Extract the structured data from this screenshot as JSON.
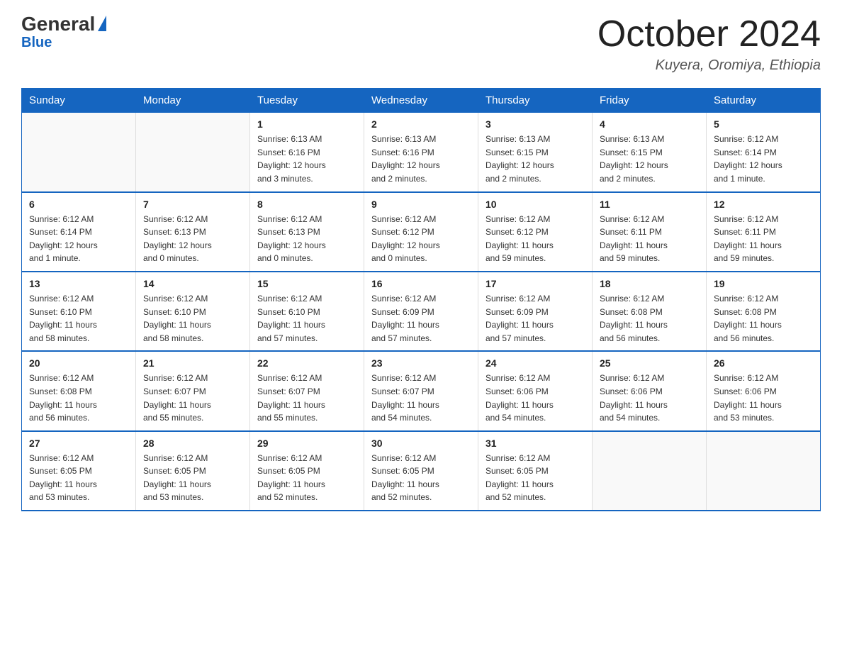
{
  "header": {
    "logo_general": "General",
    "logo_blue": "Blue",
    "month_title": "October 2024",
    "location": "Kuyera, Oromiya, Ethiopia"
  },
  "days_of_week": [
    "Sunday",
    "Monday",
    "Tuesday",
    "Wednesday",
    "Thursday",
    "Friday",
    "Saturday"
  ],
  "weeks": [
    [
      {
        "num": "",
        "info": ""
      },
      {
        "num": "",
        "info": ""
      },
      {
        "num": "1",
        "info": "Sunrise: 6:13 AM\nSunset: 6:16 PM\nDaylight: 12 hours\nand 3 minutes."
      },
      {
        "num": "2",
        "info": "Sunrise: 6:13 AM\nSunset: 6:16 PM\nDaylight: 12 hours\nand 2 minutes."
      },
      {
        "num": "3",
        "info": "Sunrise: 6:13 AM\nSunset: 6:15 PM\nDaylight: 12 hours\nand 2 minutes."
      },
      {
        "num": "4",
        "info": "Sunrise: 6:13 AM\nSunset: 6:15 PM\nDaylight: 12 hours\nand 2 minutes."
      },
      {
        "num": "5",
        "info": "Sunrise: 6:12 AM\nSunset: 6:14 PM\nDaylight: 12 hours\nand 1 minute."
      }
    ],
    [
      {
        "num": "6",
        "info": "Sunrise: 6:12 AM\nSunset: 6:14 PM\nDaylight: 12 hours\nand 1 minute."
      },
      {
        "num": "7",
        "info": "Sunrise: 6:12 AM\nSunset: 6:13 PM\nDaylight: 12 hours\nand 0 minutes."
      },
      {
        "num": "8",
        "info": "Sunrise: 6:12 AM\nSunset: 6:13 PM\nDaylight: 12 hours\nand 0 minutes."
      },
      {
        "num": "9",
        "info": "Sunrise: 6:12 AM\nSunset: 6:12 PM\nDaylight: 12 hours\nand 0 minutes."
      },
      {
        "num": "10",
        "info": "Sunrise: 6:12 AM\nSunset: 6:12 PM\nDaylight: 11 hours\nand 59 minutes."
      },
      {
        "num": "11",
        "info": "Sunrise: 6:12 AM\nSunset: 6:11 PM\nDaylight: 11 hours\nand 59 minutes."
      },
      {
        "num": "12",
        "info": "Sunrise: 6:12 AM\nSunset: 6:11 PM\nDaylight: 11 hours\nand 59 minutes."
      }
    ],
    [
      {
        "num": "13",
        "info": "Sunrise: 6:12 AM\nSunset: 6:10 PM\nDaylight: 11 hours\nand 58 minutes."
      },
      {
        "num": "14",
        "info": "Sunrise: 6:12 AM\nSunset: 6:10 PM\nDaylight: 11 hours\nand 58 minutes."
      },
      {
        "num": "15",
        "info": "Sunrise: 6:12 AM\nSunset: 6:10 PM\nDaylight: 11 hours\nand 57 minutes."
      },
      {
        "num": "16",
        "info": "Sunrise: 6:12 AM\nSunset: 6:09 PM\nDaylight: 11 hours\nand 57 minutes."
      },
      {
        "num": "17",
        "info": "Sunrise: 6:12 AM\nSunset: 6:09 PM\nDaylight: 11 hours\nand 57 minutes."
      },
      {
        "num": "18",
        "info": "Sunrise: 6:12 AM\nSunset: 6:08 PM\nDaylight: 11 hours\nand 56 minutes."
      },
      {
        "num": "19",
        "info": "Sunrise: 6:12 AM\nSunset: 6:08 PM\nDaylight: 11 hours\nand 56 minutes."
      }
    ],
    [
      {
        "num": "20",
        "info": "Sunrise: 6:12 AM\nSunset: 6:08 PM\nDaylight: 11 hours\nand 56 minutes."
      },
      {
        "num": "21",
        "info": "Sunrise: 6:12 AM\nSunset: 6:07 PM\nDaylight: 11 hours\nand 55 minutes."
      },
      {
        "num": "22",
        "info": "Sunrise: 6:12 AM\nSunset: 6:07 PM\nDaylight: 11 hours\nand 55 minutes."
      },
      {
        "num": "23",
        "info": "Sunrise: 6:12 AM\nSunset: 6:07 PM\nDaylight: 11 hours\nand 54 minutes."
      },
      {
        "num": "24",
        "info": "Sunrise: 6:12 AM\nSunset: 6:06 PM\nDaylight: 11 hours\nand 54 minutes."
      },
      {
        "num": "25",
        "info": "Sunrise: 6:12 AM\nSunset: 6:06 PM\nDaylight: 11 hours\nand 54 minutes."
      },
      {
        "num": "26",
        "info": "Sunrise: 6:12 AM\nSunset: 6:06 PM\nDaylight: 11 hours\nand 53 minutes."
      }
    ],
    [
      {
        "num": "27",
        "info": "Sunrise: 6:12 AM\nSunset: 6:05 PM\nDaylight: 11 hours\nand 53 minutes."
      },
      {
        "num": "28",
        "info": "Sunrise: 6:12 AM\nSunset: 6:05 PM\nDaylight: 11 hours\nand 53 minutes."
      },
      {
        "num": "29",
        "info": "Sunrise: 6:12 AM\nSunset: 6:05 PM\nDaylight: 11 hours\nand 52 minutes."
      },
      {
        "num": "30",
        "info": "Sunrise: 6:12 AM\nSunset: 6:05 PM\nDaylight: 11 hours\nand 52 minutes."
      },
      {
        "num": "31",
        "info": "Sunrise: 6:12 AM\nSunset: 6:05 PM\nDaylight: 11 hours\nand 52 minutes."
      },
      {
        "num": "",
        "info": ""
      },
      {
        "num": "",
        "info": ""
      }
    ]
  ]
}
